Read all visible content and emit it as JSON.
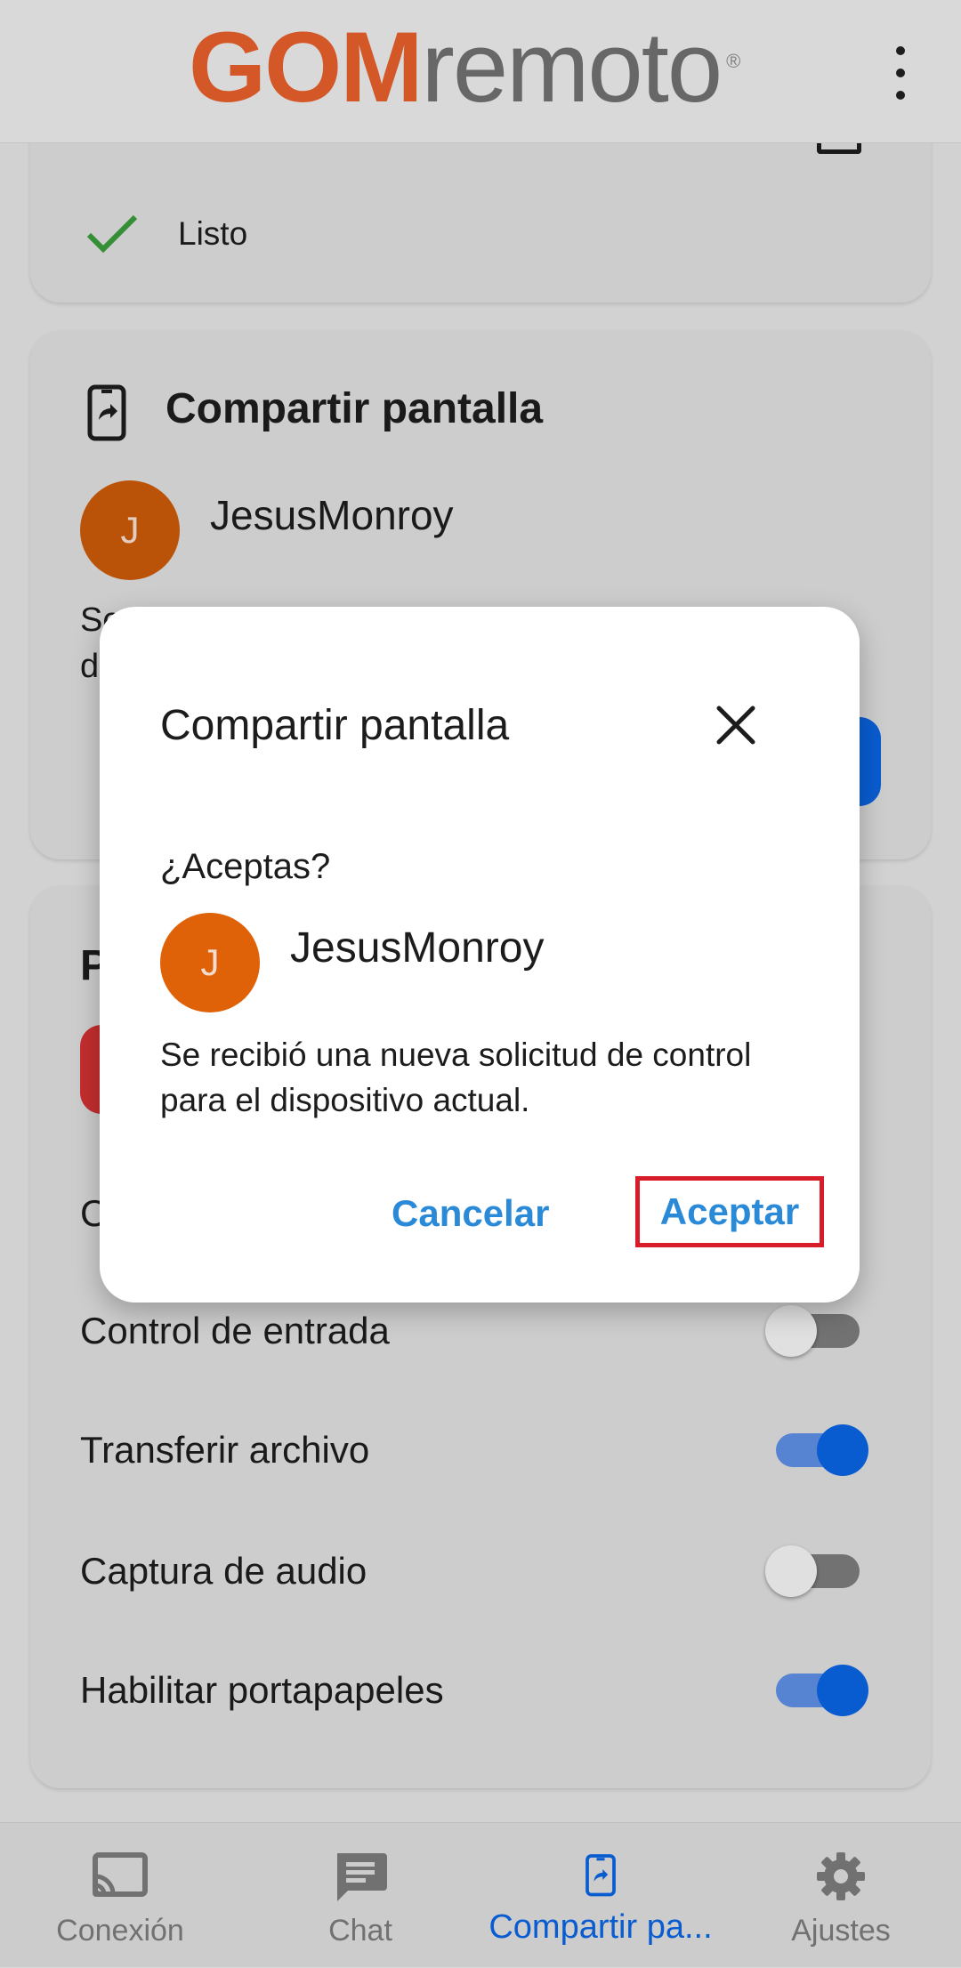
{
  "app": {
    "logo_primary": "GOM",
    "logo_secondary": "remoto",
    "logo_reg": "®"
  },
  "background": {
    "status_text": "Listo",
    "share_card_title": "Compartir pantalla",
    "share_user": "JesusMonroy",
    "share_avatar_initial": "J",
    "cut_text_line1": "Se",
    "cut_text_line2": "d",
    "section_cut_letter": "P",
    "option_cut_letter": "C",
    "toggles": [
      {
        "label": "Control de entrada",
        "state": "off"
      },
      {
        "label": "Transferir archivo",
        "state": "on"
      },
      {
        "label": "Captura de audio",
        "state": "off"
      },
      {
        "label": "Habilitar portapapeles",
        "state": "on"
      }
    ]
  },
  "dialog": {
    "title": "Compartir pantalla",
    "question": "¿Aceptas?",
    "user": "JesusMonroy",
    "avatar_initial": "J",
    "message": "Se recibió una nueva solicitud de control para el dispositivo actual.",
    "cancel_label": "Cancelar",
    "accept_label": "Aceptar"
  },
  "bottom_nav": [
    {
      "label": "Conexión",
      "icon": "cast-icon",
      "active": false
    },
    {
      "label": "Chat",
      "icon": "chat-icon",
      "active": false
    },
    {
      "label": "Compartir pa...",
      "icon": "screen-share-icon",
      "active": true
    },
    {
      "label": "Ajustes",
      "icon": "gear-icon",
      "active": false
    }
  ],
  "colors": {
    "brand_orange": "#e35e2b",
    "accent_blue": "#0a63e0",
    "link_blue": "#2b8ad8",
    "avatar_orange": "#df6208",
    "highlight_red": "#d71d2a"
  }
}
